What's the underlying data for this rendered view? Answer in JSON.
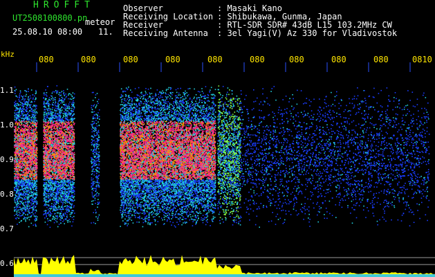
{
  "header": {
    "app_title": "HROFFT",
    "file_name": "UT2508100800.pn",
    "meteor_label": "meteor",
    "datetime": "25.08.10 08:00",
    "count": "11."
  },
  "info": [
    {
      "label": "Observer",
      "value": ": Masaki Kano"
    },
    {
      "label": "Receiving Location",
      "value": ": Shibukawa, Gunma, Japan"
    },
    {
      "label": "Receiver",
      "value": ": RTL-SDR SDR# 43dB L15 103.2MHz CW"
    },
    {
      "label": "Receiving Antenna",
      "value": ": 3el Yagi(V) Az 330 for Vladivostok"
    }
  ],
  "chart_data": {
    "type": "heatmap",
    "ylabel": "kHz",
    "y_ticks": [
      "1.1",
      "1.0",
      "0.9",
      "0.8",
      "0.7",
      "0.6"
    ],
    "x_ticks": [
      "080",
      "080",
      "080",
      "080",
      "080",
      "080",
      "080",
      "080",
      "080",
      "0810"
    ],
    "ylim": [
      0.55,
      1.17
    ],
    "bursts": [
      {
        "x_start": 0.0,
        "x_end": 0.55,
        "intensity": "high"
      },
      {
        "x_start": 0.7,
        "x_end": 1.45,
        "intensity": "high"
      },
      {
        "x_start": 1.85,
        "x_end": 2.05,
        "intensity": "low"
      },
      {
        "x_start": 2.55,
        "x_end": 4.85,
        "intensity": "high"
      },
      {
        "x_start": 4.9,
        "x_end": 5.45,
        "intensity": "medium"
      },
      {
        "x_start": 5.45,
        "x_end": 10.0,
        "intensity": "very-low"
      }
    ],
    "colors": {
      "low": "#1a3cff",
      "mid": "#22d0e0",
      "high": "#ff2a8a",
      "signal": "#ffff00",
      "noise": "#1fc0ff"
    }
  }
}
